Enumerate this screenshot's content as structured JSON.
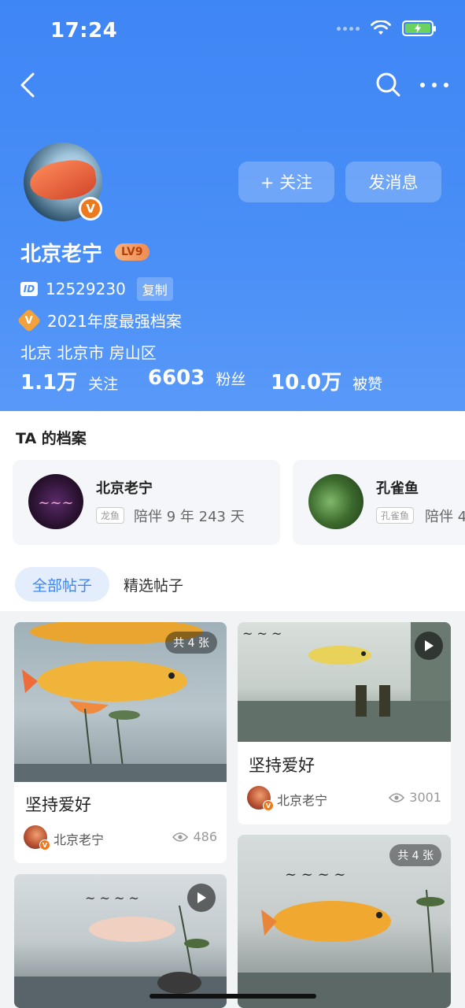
{
  "status_bar": {
    "time": "17:24"
  },
  "profile": {
    "name": "北京老宁",
    "level": "LV9",
    "id_label": "12529230",
    "copy_label": "复制",
    "honor": "2021年度最强档案",
    "location": "北京 北京市 房山区",
    "follow_label": "+ 关注",
    "message_label": "发消息",
    "badge": "V",
    "id_icon": "ID"
  },
  "stats": [
    {
      "num": "1.1万",
      "label": "关注"
    },
    {
      "num": "6603",
      "label": "粉丝"
    },
    {
      "num": "10.0万",
      "label": "被赞"
    }
  ],
  "archive": {
    "title": "TA 的档案",
    "cards": [
      {
        "name": "北京老宁",
        "tag": "龙鱼",
        "days": "陪伴 9 年 243 天"
      },
      {
        "name": "孔雀鱼",
        "tag": "孔雀鱼",
        "days": "陪伴 4"
      }
    ]
  },
  "tabs": {
    "all": "全部帖子",
    "selected": "精选帖子"
  },
  "posts": [
    {
      "title": "坚持爱好",
      "author": "北京老宁",
      "views": "486",
      "count": "共 4 张"
    },
    {
      "title": "坚持爱好",
      "author": "北京老宁",
      "views": "3001"
    },
    {
      "title": "",
      "count": "共 4 张"
    },
    {
      "title": ""
    }
  ],
  "colors": {
    "header": "#4a8ff7",
    "accent": "#3f86f5",
    "badge": "#ee7a1f"
  }
}
